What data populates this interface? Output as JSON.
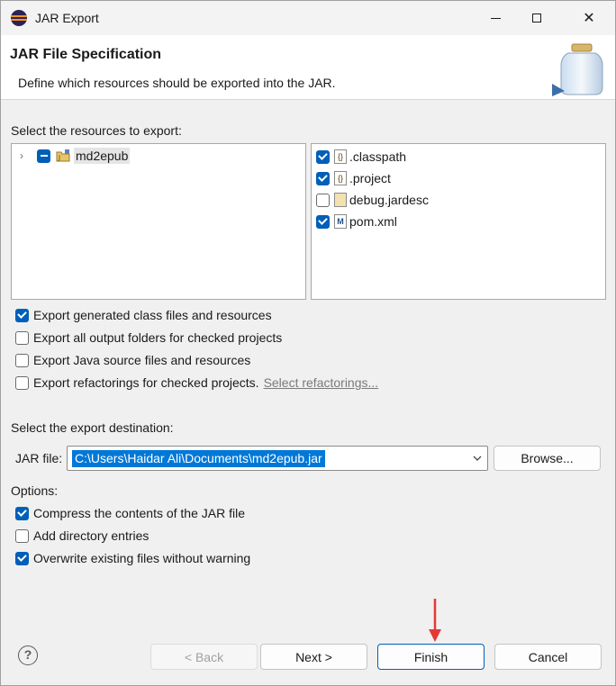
{
  "window": {
    "title": "JAR Export",
    "controls": {
      "close": "✕"
    }
  },
  "banner": {
    "title": "JAR File Specification",
    "description": "Define which resources should be exported into the JAR."
  },
  "resources": {
    "label": "Select the resources to export:",
    "tree": [
      {
        "name": "md2epub",
        "state": "partial",
        "expanded": false
      }
    ],
    "files": [
      {
        "name": ".classpath",
        "checked": true,
        "icon": "x-icon"
      },
      {
        "name": ".project",
        "checked": true,
        "icon": "x-icon"
      },
      {
        "name": "debug.jardesc",
        "checked": false,
        "icon": "jar-icon"
      },
      {
        "name": "pom.xml",
        "checked": true,
        "icon": "m-icon"
      }
    ]
  },
  "export_options": [
    {
      "label": "Export generated class files and resources",
      "checked": true
    },
    {
      "label": "Export all output folders for checked projects",
      "checked": false
    },
    {
      "label": "Export Java source files and resources",
      "checked": false
    },
    {
      "label": "Export refactorings for checked projects.",
      "checked": false,
      "link": "Select refactorings..."
    }
  ],
  "destination": {
    "label": "Select the export destination:",
    "field_label": "JAR file:",
    "value": "C:\\Users\\Haidar Ali\\Documents\\md2epub.jar",
    "browse": "Browse..."
  },
  "options": {
    "label": "Options:",
    "items": [
      {
        "label": "Compress the contents of the JAR file",
        "checked": true
      },
      {
        "label": "Add directory entries",
        "checked": false
      },
      {
        "label": "Overwrite existing files without warning",
        "checked": true
      }
    ]
  },
  "footer": {
    "help": "?",
    "back": "< Back",
    "next": "Next >",
    "finish": "Finish",
    "cancel": "Cancel"
  },
  "colors": {
    "accent": "#005fb8",
    "selection": "#0078d7",
    "annotation_arrow": "#e53935"
  }
}
